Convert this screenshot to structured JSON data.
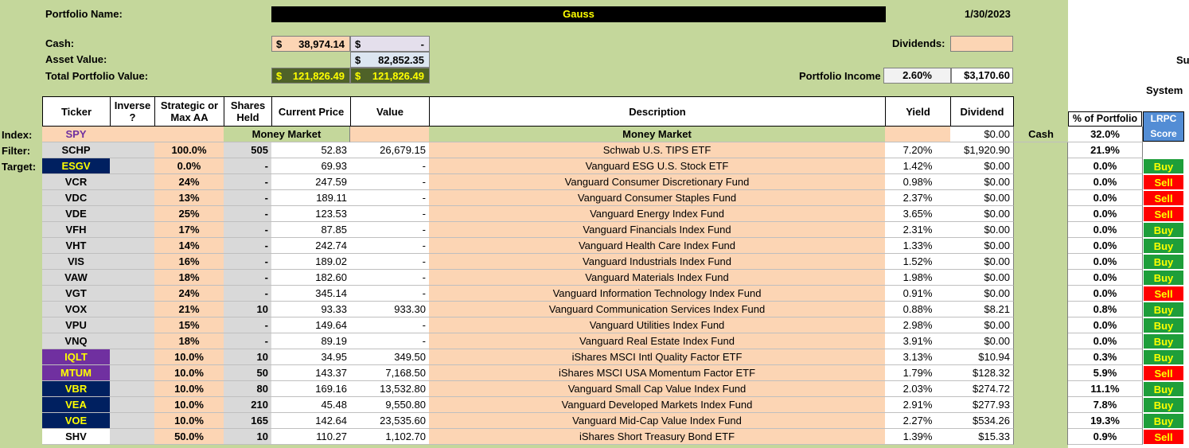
{
  "portfolio": {
    "name_label": "Portfolio Name:",
    "name": "Gauss",
    "date": "1/30/2023",
    "cash_label": "Cash:",
    "cash_currency": "$",
    "cash_value": "38,974.14",
    "cash2_currency": "$",
    "cash2_value": "-",
    "asset_label": "Asset Value:",
    "asset_currency": "$",
    "asset_value": "82,852.35",
    "total_label": "Total Portfolio Value:",
    "total_currency": "$",
    "total_value": "121,826.49",
    "total2_currency": "$",
    "total2_value": "121,826.49",
    "dividends_label": "Dividends:",
    "income_label": "Portfolio Income",
    "income_pct": "2.60%",
    "income_value": "$3,170.60",
    "side_text_1": "Su",
    "side_text_2": "System"
  },
  "headers": {
    "ticker": "Ticker",
    "inverse": "Inverse ?",
    "strategic": "Strategic or Max AA",
    "shares": "Shares Held",
    "price": "Current Price",
    "value": "Value",
    "description": "Description",
    "yield": "Yield",
    "dividend": "Dividend",
    "pct": "% of Portfolio",
    "lrpc": "LRPC Score"
  },
  "row_labels": {
    "index": "Index:",
    "filter": "Filter:",
    "target": "Target:"
  },
  "index_row": {
    "ticker": "SPY",
    "shares_price": "Money Market",
    "description": "Money Market",
    "dividend": "$0.00",
    "cash": "Cash",
    "pct": "32.0%"
  },
  "rows": [
    {
      "ticker": "SCHP",
      "tcolor": "gray",
      "inverse": "",
      "aa": "100.0%",
      "shares": "505",
      "price": "52.83",
      "value": "26,679.15",
      "description": "Schwab U.S. TIPS ETF",
      "yield": "7.20%",
      "dividend": "$1,920.90",
      "pct": "21.9%",
      "score": ""
    },
    {
      "ticker": "ESGV",
      "tcolor": "navy",
      "inverse": "",
      "aa": "0.0%",
      "shares": "-",
      "price": "69.93",
      "value": "-",
      "description": "Vanguard ESG U.S. Stock ETF",
      "yield": "1.42%",
      "dividend": "$0.00",
      "pct": "0.0%",
      "score": "Buy"
    },
    {
      "ticker": "VCR",
      "tcolor": "gray",
      "inverse": "",
      "aa": "24%",
      "shares": "-",
      "price": "247.59",
      "value": "-",
      "description": "Vanguard Consumer Discretionary Fund",
      "yield": "0.98%",
      "dividend": "$0.00",
      "pct": "0.0%",
      "score": "Sell"
    },
    {
      "ticker": "VDC",
      "tcolor": "gray",
      "inverse": "",
      "aa": "13%",
      "shares": "-",
      "price": "189.11",
      "value": "-",
      "description": "Vanguard Consumer Staples Fund",
      "yield": "2.37%",
      "dividend": "$0.00",
      "pct": "0.0%",
      "score": "Sell"
    },
    {
      "ticker": "VDE",
      "tcolor": "gray",
      "inverse": "",
      "aa": "25%",
      "shares": "-",
      "price": "123.53",
      "value": "-",
      "description": "Vanguard Energy Index Fund",
      "yield": "3.65%",
      "dividend": "$0.00",
      "pct": "0.0%",
      "score": "Sell"
    },
    {
      "ticker": "VFH",
      "tcolor": "gray",
      "inverse": "",
      "aa": "17%",
      "shares": "-",
      "price": "87.85",
      "value": "-",
      "description": "Vanguard Financials Index Fund",
      "yield": "2.31%",
      "dividend": "$0.00",
      "pct": "0.0%",
      "score": "Buy"
    },
    {
      "ticker": "VHT",
      "tcolor": "gray",
      "inverse": "",
      "aa": "14%",
      "shares": "-",
      "price": "242.74",
      "value": "-",
      "description": "Vanguard Health Care Index Fund",
      "yield": "1.33%",
      "dividend": "$0.00",
      "pct": "0.0%",
      "score": "Buy"
    },
    {
      "ticker": "VIS",
      "tcolor": "gray",
      "inverse": "",
      "aa": "16%",
      "shares": "-",
      "price": "189.02",
      "value": "-",
      "description": "Vanguard Industrials Index Fund",
      "yield": "1.52%",
      "dividend": "$0.00",
      "pct": "0.0%",
      "score": "Buy"
    },
    {
      "ticker": "VAW",
      "tcolor": "gray",
      "inverse": "",
      "aa": "18%",
      "shares": "-",
      "price": "182.60",
      "value": "-",
      "description": "Vanguard Materials Index Fund",
      "yield": "1.98%",
      "dividend": "$0.00",
      "pct": "0.0%",
      "score": "Buy"
    },
    {
      "ticker": "VGT",
      "tcolor": "gray",
      "inverse": "",
      "aa": "24%",
      "shares": "-",
      "price": "345.14",
      "value": "-",
      "description": "Vanguard Information Technology Index Fund",
      "yield": "0.91%",
      "dividend": "$0.00",
      "pct": "0.0%",
      "score": "Sell"
    },
    {
      "ticker": "VOX",
      "tcolor": "gray",
      "inverse": "",
      "aa": "21%",
      "shares": "10",
      "price": "93.33",
      "value": "933.30",
      "description": "Vanguard Communication Services Index Fund",
      "yield": "0.88%",
      "dividend": "$8.21",
      "pct": "0.8%",
      "score": "Buy"
    },
    {
      "ticker": "VPU",
      "tcolor": "gray",
      "inverse": "",
      "aa": "15%",
      "shares": "-",
      "price": "149.64",
      "value": "-",
      "description": "Vanguard Utilities Index Fund",
      "yield": "2.98%",
      "dividend": "$0.00",
      "pct": "0.0%",
      "score": "Buy"
    },
    {
      "ticker": "VNQ",
      "tcolor": "gray",
      "inverse": "",
      "aa": "18%",
      "shares": "-",
      "price": "89.19",
      "value": "-",
      "description": "Vanguard Real Estate Index Fund",
      "yield": "3.91%",
      "dividend": "$0.00",
      "pct": "0.0%",
      "score": "Buy"
    },
    {
      "ticker": "IQLT",
      "tcolor": "purple",
      "inverse": "",
      "aa": "10.0%",
      "shares": "10",
      "price": "34.95",
      "value": "349.50",
      "description": "iShares MSCI Intl Quality Factor ETF",
      "yield": "3.13%",
      "dividend": "$10.94",
      "pct": "0.3%",
      "score": "Buy"
    },
    {
      "ticker": "MTUM",
      "tcolor": "purple",
      "inverse": "",
      "aa": "10.0%",
      "shares": "50",
      "price": "143.37",
      "value": "7,168.50",
      "description": "iShares MSCI USA Momentum Factor ETF",
      "yield": "1.79%",
      "dividend": "$128.32",
      "pct": "5.9%",
      "score": "Sell"
    },
    {
      "ticker": "VBR",
      "tcolor": "navy",
      "inverse": "",
      "aa": "10.0%",
      "shares": "80",
      "price": "169.16",
      "value": "13,532.80",
      "description": "Vanguard Small Cap Value Index Fund",
      "yield": "2.03%",
      "dividend": "$274.72",
      "pct": "11.1%",
      "score": "Buy"
    },
    {
      "ticker": "VEA",
      "tcolor": "navy",
      "inverse": "",
      "aa": "10.0%",
      "shares": "210",
      "price": "45.48",
      "value": "9,550.80",
      "description": "Vanguard Developed Markets Index Fund",
      "yield": "2.91%",
      "dividend": "$277.93",
      "pct": "7.8%",
      "score": "Buy"
    },
    {
      "ticker": "VOE",
      "tcolor": "navy",
      "inverse": "",
      "aa": "10.0%",
      "shares": "165",
      "price": "142.64",
      "value": "23,535.60",
      "description": "Vanguard Mid-Cap Value Index Fund",
      "yield": "2.27%",
      "dividend": "$534.26",
      "pct": "19.3%",
      "score": "Buy"
    },
    {
      "ticker": "SHV",
      "tcolor": "white",
      "inverse": "",
      "aa": "50.0%",
      "shares": "10",
      "price": "110.27",
      "value": "1,102.70",
      "description": "iShares Short Treasury Bond ETF",
      "yield": "1.39%",
      "dividend": "$15.33",
      "pct": "0.9%",
      "score": "Sell"
    }
  ],
  "colors": {
    "sheet_green": "#c4d79b",
    "peach": "#fcd5b4",
    "gray_cell": "#d9d9d9",
    "navy": "#002060",
    "purple": "#7030a0",
    "olive": "#4f6228",
    "buy_green": "#1e9e3a",
    "sell_red": "#ff0000",
    "lrpc_blue": "#538dd5"
  }
}
